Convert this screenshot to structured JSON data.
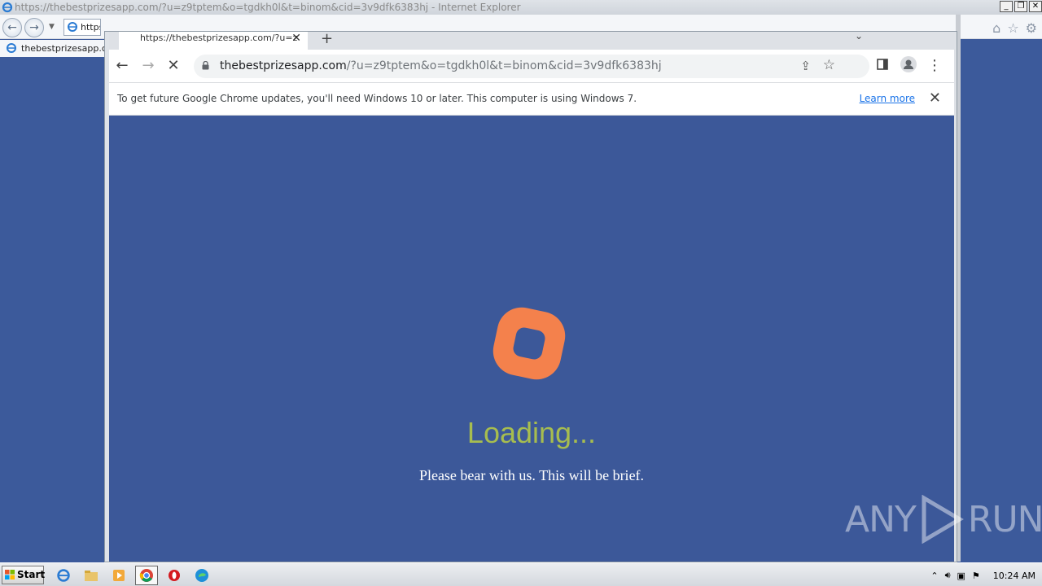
{
  "ie": {
    "title": "https://thebestprizesapp.com/?u=z9tptem&o=tgdkh0l&t=binom&cid=3v9dfk6383hj - Internet Explorer",
    "address_short": "https",
    "favorite_label": "thebestprizesapp.co"
  },
  "chrome": {
    "tab_title": "https://thebestprizesapp.com/?u=z",
    "url_domain": "thebestprizesapp.com",
    "url_path": "/?u=z9tptem&o=tgdkh0l&t=binom&cid=3v9dfk6383hj",
    "infobar_message": "To get future Google Chrome updates, you'll need Windows 10 or later. This computer is using Windows 7.",
    "infobar_link": "Learn more"
  },
  "page": {
    "loading_text": "Loading...",
    "subtext": "Please bear with us. This will be brief.",
    "logo_color": "#f4814c",
    "background_color": "#3c5899"
  },
  "watermark": {
    "left": "ANY",
    "right": "RUN"
  },
  "taskbar": {
    "start_label": "Start",
    "clock": "10:24 AM"
  },
  "colors": {
    "loading_text": "#a7bd4f",
    "link": "#1a73e8"
  }
}
